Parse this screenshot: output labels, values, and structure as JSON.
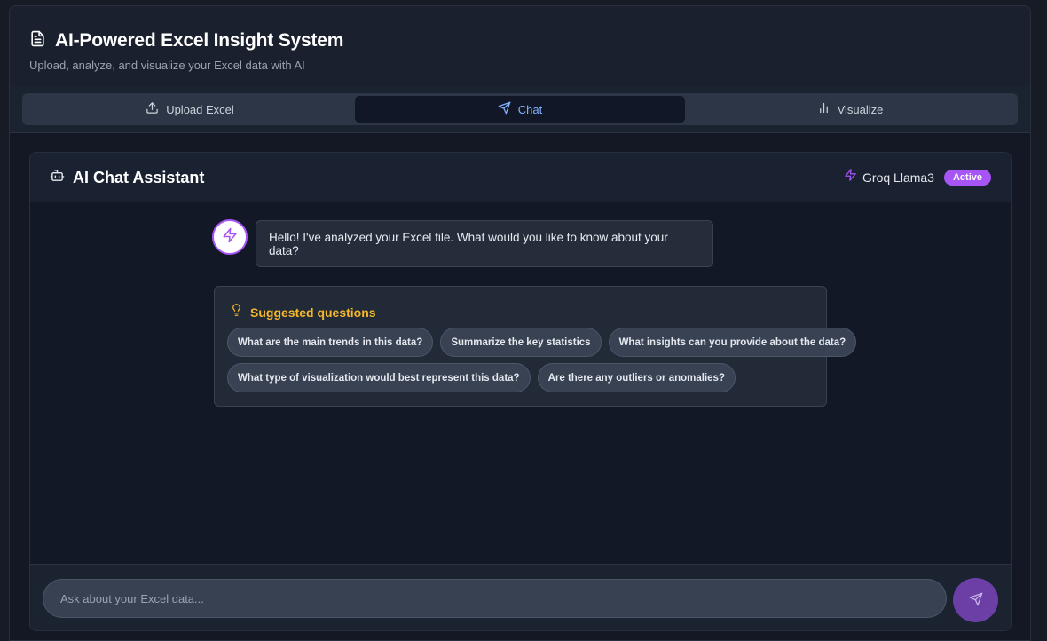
{
  "header": {
    "title": "AI-Powered Excel Insight System",
    "subtitle": "Upload, analyze, and visualize your Excel data with AI",
    "icon": "file-text-icon"
  },
  "tabs": [
    {
      "label": "Upload Excel",
      "icon": "upload-icon",
      "active": false
    },
    {
      "label": "Chat",
      "icon": "send-icon",
      "active": true
    },
    {
      "label": "Visualize",
      "icon": "bar-chart-icon",
      "active": false
    }
  ],
  "chat": {
    "title": "AI Chat Assistant",
    "title_icon": "bot-icon",
    "model": "Groq Llama3",
    "model_icon": "zap-icon",
    "status": "Active",
    "messages": [
      {
        "role": "assistant",
        "text": "Hello! I've analyzed your Excel file. What would you like to know about your data?"
      }
    ],
    "suggestions": {
      "title": "Suggested questions",
      "icon": "lightbulb-icon",
      "items": [
        "What are the main trends in this data?",
        "Summarize the key statistics",
        "What insights can you provide about the data?",
        "What type of visualization would best represent this data?",
        "Are there any outliers or anomalies?"
      ]
    },
    "input": {
      "placeholder": "Ask about your Excel data...",
      "value": ""
    }
  },
  "colors": {
    "accent": "#a855f7",
    "active_tab_text": "#7fb0ff",
    "suggest_title": "#f5b72a",
    "send_button": "#6b3fa6"
  }
}
